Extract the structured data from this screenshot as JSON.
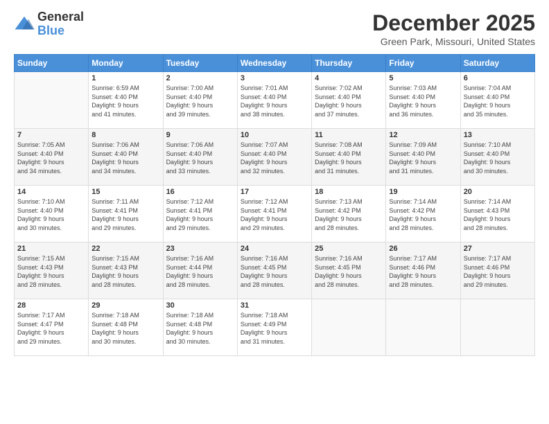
{
  "header": {
    "logo_line1": "General",
    "logo_line2": "Blue",
    "title": "December 2025",
    "location": "Green Park, Missouri, United States"
  },
  "weekdays": [
    "Sunday",
    "Monday",
    "Tuesday",
    "Wednesday",
    "Thursday",
    "Friday",
    "Saturday"
  ],
  "weeks": [
    [
      {
        "day": "",
        "info": ""
      },
      {
        "day": "1",
        "info": "Sunrise: 6:59 AM\nSunset: 4:40 PM\nDaylight: 9 hours\nand 41 minutes."
      },
      {
        "day": "2",
        "info": "Sunrise: 7:00 AM\nSunset: 4:40 PM\nDaylight: 9 hours\nand 39 minutes."
      },
      {
        "day": "3",
        "info": "Sunrise: 7:01 AM\nSunset: 4:40 PM\nDaylight: 9 hours\nand 38 minutes."
      },
      {
        "day": "4",
        "info": "Sunrise: 7:02 AM\nSunset: 4:40 PM\nDaylight: 9 hours\nand 37 minutes."
      },
      {
        "day": "5",
        "info": "Sunrise: 7:03 AM\nSunset: 4:40 PM\nDaylight: 9 hours\nand 36 minutes."
      },
      {
        "day": "6",
        "info": "Sunrise: 7:04 AM\nSunset: 4:40 PM\nDaylight: 9 hours\nand 35 minutes."
      }
    ],
    [
      {
        "day": "7",
        "info": "Sunrise: 7:05 AM\nSunset: 4:40 PM\nDaylight: 9 hours\nand 34 minutes."
      },
      {
        "day": "8",
        "info": "Sunrise: 7:06 AM\nSunset: 4:40 PM\nDaylight: 9 hours\nand 34 minutes."
      },
      {
        "day": "9",
        "info": "Sunrise: 7:06 AM\nSunset: 4:40 PM\nDaylight: 9 hours\nand 33 minutes."
      },
      {
        "day": "10",
        "info": "Sunrise: 7:07 AM\nSunset: 4:40 PM\nDaylight: 9 hours\nand 32 minutes."
      },
      {
        "day": "11",
        "info": "Sunrise: 7:08 AM\nSunset: 4:40 PM\nDaylight: 9 hours\nand 31 minutes."
      },
      {
        "day": "12",
        "info": "Sunrise: 7:09 AM\nSunset: 4:40 PM\nDaylight: 9 hours\nand 31 minutes."
      },
      {
        "day": "13",
        "info": "Sunrise: 7:10 AM\nSunset: 4:40 PM\nDaylight: 9 hours\nand 30 minutes."
      }
    ],
    [
      {
        "day": "14",
        "info": "Sunrise: 7:10 AM\nSunset: 4:40 PM\nDaylight: 9 hours\nand 30 minutes."
      },
      {
        "day": "15",
        "info": "Sunrise: 7:11 AM\nSunset: 4:41 PM\nDaylight: 9 hours\nand 29 minutes."
      },
      {
        "day": "16",
        "info": "Sunrise: 7:12 AM\nSunset: 4:41 PM\nDaylight: 9 hours\nand 29 minutes."
      },
      {
        "day": "17",
        "info": "Sunrise: 7:12 AM\nSunset: 4:41 PM\nDaylight: 9 hours\nand 29 minutes."
      },
      {
        "day": "18",
        "info": "Sunrise: 7:13 AM\nSunset: 4:42 PM\nDaylight: 9 hours\nand 28 minutes."
      },
      {
        "day": "19",
        "info": "Sunrise: 7:14 AM\nSunset: 4:42 PM\nDaylight: 9 hours\nand 28 minutes."
      },
      {
        "day": "20",
        "info": "Sunrise: 7:14 AM\nSunset: 4:43 PM\nDaylight: 9 hours\nand 28 minutes."
      }
    ],
    [
      {
        "day": "21",
        "info": "Sunrise: 7:15 AM\nSunset: 4:43 PM\nDaylight: 9 hours\nand 28 minutes."
      },
      {
        "day": "22",
        "info": "Sunrise: 7:15 AM\nSunset: 4:43 PM\nDaylight: 9 hours\nand 28 minutes."
      },
      {
        "day": "23",
        "info": "Sunrise: 7:16 AM\nSunset: 4:44 PM\nDaylight: 9 hours\nand 28 minutes."
      },
      {
        "day": "24",
        "info": "Sunrise: 7:16 AM\nSunset: 4:45 PM\nDaylight: 9 hours\nand 28 minutes."
      },
      {
        "day": "25",
        "info": "Sunrise: 7:16 AM\nSunset: 4:45 PM\nDaylight: 9 hours\nand 28 minutes."
      },
      {
        "day": "26",
        "info": "Sunrise: 7:17 AM\nSunset: 4:46 PM\nDaylight: 9 hours\nand 28 minutes."
      },
      {
        "day": "27",
        "info": "Sunrise: 7:17 AM\nSunset: 4:46 PM\nDaylight: 9 hours\nand 29 minutes."
      }
    ],
    [
      {
        "day": "28",
        "info": "Sunrise: 7:17 AM\nSunset: 4:47 PM\nDaylight: 9 hours\nand 29 minutes."
      },
      {
        "day": "29",
        "info": "Sunrise: 7:18 AM\nSunset: 4:48 PM\nDaylight: 9 hours\nand 30 minutes."
      },
      {
        "day": "30",
        "info": "Sunrise: 7:18 AM\nSunset: 4:48 PM\nDaylight: 9 hours\nand 30 minutes."
      },
      {
        "day": "31",
        "info": "Sunrise: 7:18 AM\nSunset: 4:49 PM\nDaylight: 9 hours\nand 31 minutes."
      },
      {
        "day": "",
        "info": ""
      },
      {
        "day": "",
        "info": ""
      },
      {
        "day": "",
        "info": ""
      }
    ]
  ]
}
